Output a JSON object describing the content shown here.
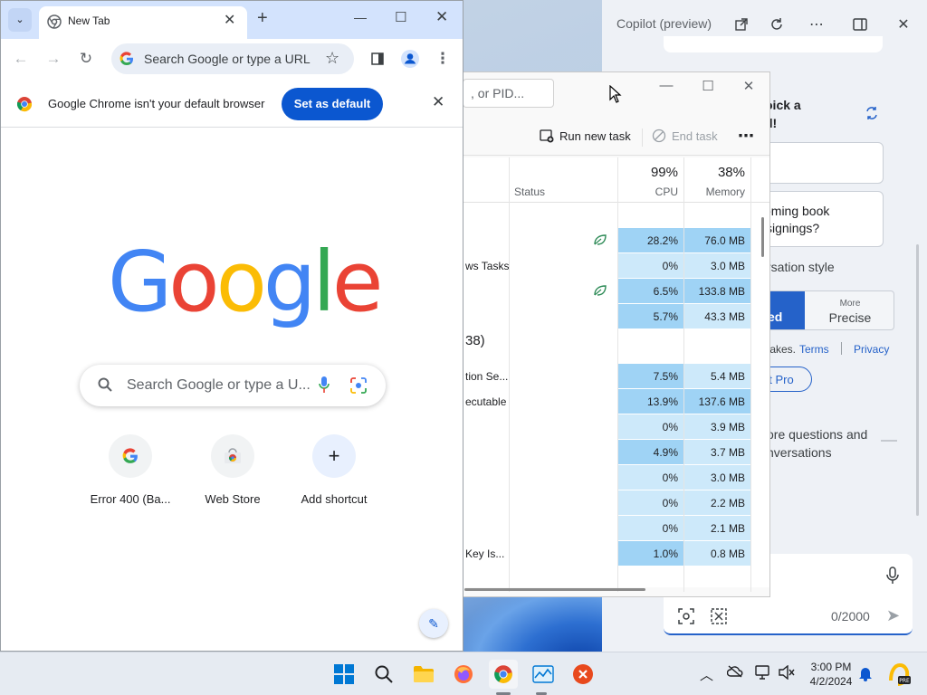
{
  "chrome": {
    "tab_title": "New Tab",
    "omnibox_placeholder": "Search Google or type a URL",
    "infobar_message": "Google Chrome isn't your default browser",
    "infobar_button": "Set as default",
    "ntp_search_placeholder": "Search Google or type a U...",
    "logo_letters": [
      "G",
      "o",
      "o",
      "g",
      "l",
      "e"
    ],
    "shortcuts": [
      {
        "label": "Error 400 (Ba...",
        "icon": "google-g-icon"
      },
      {
        "label": "Web Store",
        "icon": "web-store-icon"
      },
      {
        "label": "Add shortcut",
        "icon": "plus-icon"
      }
    ]
  },
  "task_manager": {
    "search_placeholder": ", or PID...",
    "run_new_task": "Run new task",
    "end_task": "End task",
    "columns": {
      "status": "Status",
      "cpu_pct": "99%",
      "cpu_label": "CPU",
      "mem_pct": "38%",
      "mem_label": "Memory"
    },
    "rows": [
      {
        "name": "",
        "cpu": "",
        "mem": "",
        "leaf": false
      },
      {
        "name": "",
        "cpu": "28.2%",
        "mem": "76.0 MB",
        "leaf": true
      },
      {
        "name": "ws Tasks",
        "cpu": "0%",
        "mem": "3.0 MB",
        "leaf": false
      },
      {
        "name": "",
        "cpu": "6.5%",
        "mem": "133.8 MB",
        "leaf": true
      },
      {
        "name": "",
        "cpu": "5.7%",
        "mem": "43.3 MB",
        "leaf": false
      },
      {
        "name": "38)",
        "cpu": "",
        "mem": "",
        "leaf": false,
        "group": true
      },
      {
        "name": "tion Se...",
        "cpu": "7.5%",
        "mem": "5.4 MB",
        "leaf": false
      },
      {
        "name": "ecutable",
        "cpu": "13.9%",
        "mem": "137.6 MB",
        "leaf": false
      },
      {
        "name": "",
        "cpu": "0%",
        "mem": "3.9 MB",
        "leaf": false
      },
      {
        "name": "",
        "cpu": "4.9%",
        "mem": "3.7 MB",
        "leaf": false
      },
      {
        "name": "",
        "cpu": "0%",
        "mem": "3.0 MB",
        "leaf": false
      },
      {
        "name": "",
        "cpu": "0%",
        "mem": "2.2 MB",
        "leaf": false
      },
      {
        "name": "",
        "cpu": "0%",
        "mem": "2.1 MB",
        "leaf": false
      },
      {
        "name": "Key Is...",
        "cpu": "1.0%",
        "mem": "0.8 MB",
        "leaf": false
      }
    ]
  },
  "copilot": {
    "title": "Copilot (preview)",
    "pick_line1": "oick a",
    "pick_line2": "d!",
    "prompt_line1": "oming book",
    "prompt_line2": "signings?",
    "style_label": "rsation style",
    "style_selected": "ed",
    "style_more": "More",
    "style_precise": "Precise",
    "mistakes": "takes.",
    "terms": "Terms",
    "privacy": "Privacy",
    "pro_pill": "ot Pro",
    "more_line1": "ore questions and",
    "more_line2": "nversations",
    "counter": "0/2000"
  },
  "taskbar": {
    "time": "3:00 PM",
    "date": "4/2/2024"
  },
  "colors": {
    "cpu_dark": "#9fd3f5",
    "cpu_light": "#cde9fa",
    "accent": "#0b57d0"
  }
}
